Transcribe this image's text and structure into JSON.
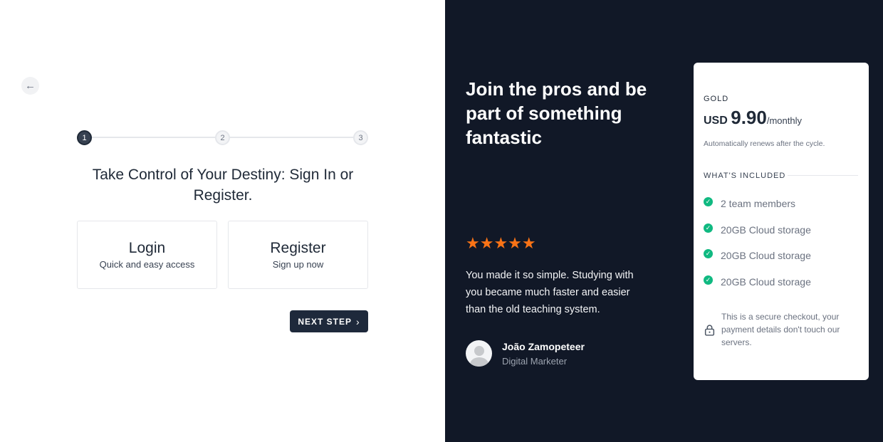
{
  "stepper": {
    "steps": [
      "1",
      "2",
      "3"
    ],
    "active": 1
  },
  "main": {
    "heading": "Take Control of Your Destiny: Sign In or Register.",
    "options": [
      {
        "title": "Login",
        "subtitle": "Quick and easy access"
      },
      {
        "title": "Register",
        "subtitle": "Sign up now"
      }
    ],
    "next_label": "NEXT STEP"
  },
  "promo": {
    "heading": "Join the pros and be part of something fantastic",
    "rating": 5,
    "stars": "★★★★★",
    "quote": "You made it so simple. Studying with you became much faster and easier than the old teaching system.",
    "author": "João Zamopeteer",
    "role": "Digital Marketer"
  },
  "plan": {
    "tier": "GOLD",
    "currency": "USD",
    "amount": "9.90",
    "period": "/monthly",
    "renew": "Automatically renews after the cycle.",
    "included_label": "WHAT'S INCLUDED",
    "features": [
      "2 team members",
      "20GB Cloud storage",
      "20GB Cloud storage",
      "20GB Cloud storage"
    ],
    "secure": "This is a secure checkout, your payment details don't touch our servers."
  },
  "colors": {
    "dark": "#111827",
    "accent": "#1e293b",
    "star": "#f97316",
    "check": "#10b981"
  }
}
